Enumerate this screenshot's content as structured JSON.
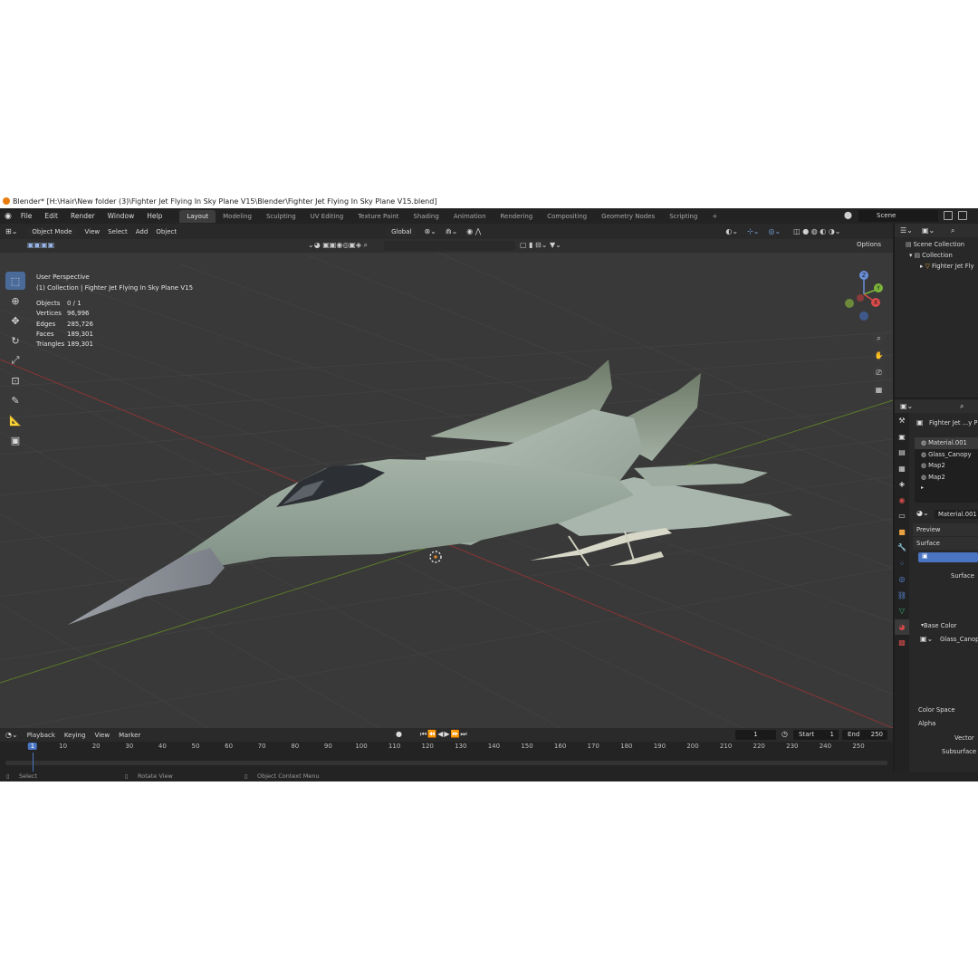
{
  "window_title": "Blender* [H:\\Hair\\New folder (3)\\Fighter Jet Flying In Sky Plane V15\\Blender\\Fighter Jet Flying In Sky Plane V15.blend]",
  "menu": [
    "File",
    "Edit",
    "Render",
    "Window",
    "Help"
  ],
  "workspace_tabs": [
    {
      "label": "Layout",
      "active": true
    },
    {
      "label": "Modeling"
    },
    {
      "label": "Sculpting"
    },
    {
      "label": "UV Editing"
    },
    {
      "label": "Texture Paint"
    },
    {
      "label": "Shading"
    },
    {
      "label": "Animation"
    },
    {
      "label": "Rendering"
    },
    {
      "label": "Compositing"
    },
    {
      "label": "Geometry Nodes"
    },
    {
      "label": "Scripting"
    }
  ],
  "scene_name": "Scene",
  "viewport": {
    "mode": "Object Mode",
    "menus": [
      "View",
      "Select",
      "Add",
      "Object"
    ],
    "orientation": "Global",
    "options_label": "Options",
    "perspective": "User Perspective",
    "collection_line": "(1) Collection | Fighter Jet Flying In Sky Plane V15",
    "stats": [
      {
        "label": "Objects",
        "value": "0 / 1"
      },
      {
        "label": "Vertices",
        "value": "96,996"
      },
      {
        "label": "Edges",
        "value": "285,726"
      },
      {
        "label": "Faces",
        "value": "189,301"
      },
      {
        "label": "Triangles",
        "value": "189,301"
      }
    ],
    "gizmo_axes": [
      "Z",
      "Y",
      "X"
    ]
  },
  "timeline": {
    "menus": [
      "Playback",
      "Keying",
      "View",
      "Marker"
    ],
    "current_frame": "1",
    "start_label": "Start",
    "start": "1",
    "end_label": "End",
    "end": "250",
    "ticks": [
      "1",
      "10",
      "20",
      "30",
      "40",
      "50",
      "60",
      "70",
      "80",
      "90",
      "100",
      "110",
      "120",
      "130",
      "140",
      "150",
      "160",
      "170",
      "180",
      "190",
      "200",
      "210",
      "220",
      "230",
      "240",
      "250"
    ]
  },
  "status": {
    "select": "Select",
    "rotate": "Rotate View",
    "context": "Object Context Menu"
  },
  "outliner": {
    "items": [
      "Scene Collection",
      "Collection",
      "Fighter Jet Fly"
    ]
  },
  "properties": {
    "object_name": "Fighter Jet ...y Pla",
    "materials": [
      "Material.001",
      "Glass_Canopy",
      "Map2",
      "Map2"
    ],
    "active_material": "Material.001",
    "preview_label": "Preview",
    "surface_label": "Surface",
    "surface_value": "Surface",
    "base_color_label": "Base Color",
    "base_color_tex": "Glass_Canopy",
    "color_space_label": "Color Space",
    "alpha_label": "Alpha",
    "vector_label": "Vector",
    "subsurface_label": "Subsurface"
  }
}
